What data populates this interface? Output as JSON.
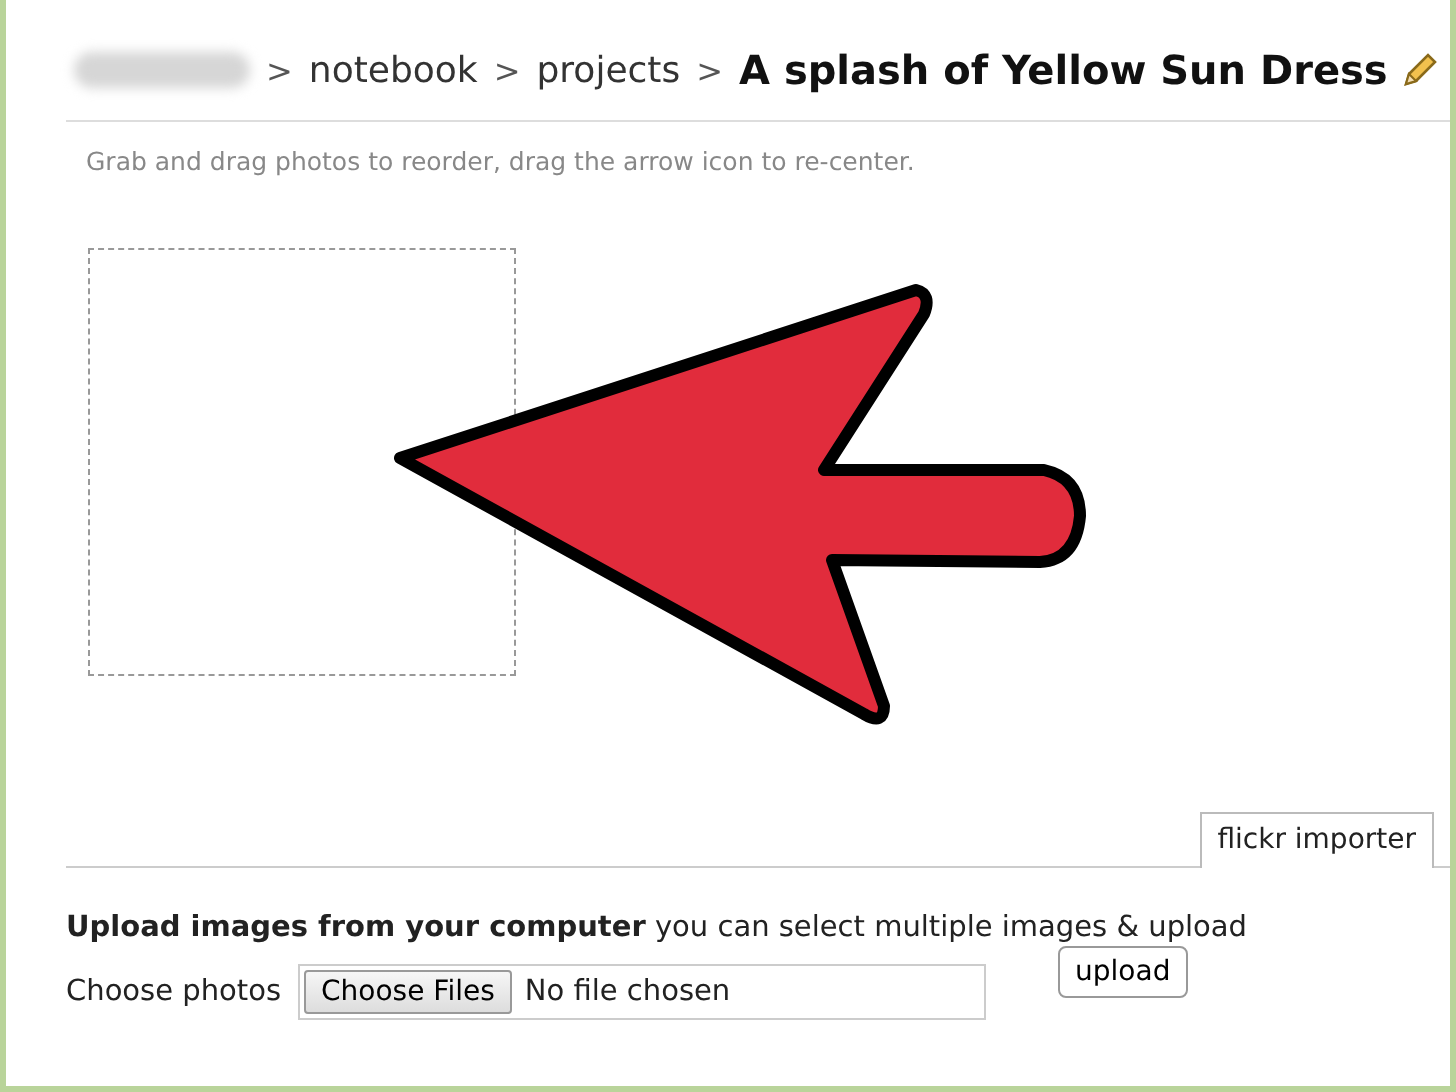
{
  "breadcrumb": {
    "items": [
      {
        "kind": "separator",
        "text": ">"
      },
      {
        "kind": "link",
        "text": "notebook"
      },
      {
        "kind": "separator",
        "text": ">"
      },
      {
        "kind": "link",
        "text": "projects"
      },
      {
        "kind": "separator",
        "text": ">"
      }
    ],
    "title": "A splash of Yellow Sun Dress"
  },
  "hint": "Grab and drag photos to reorder, drag the arrow icon to re-center.",
  "tabs": [
    {
      "label": "flickr importer",
      "selected": true
    }
  ],
  "upload": {
    "heading": "**Upload images from your computer** you can select multiple images & upload",
    "label": "Choose photos",
    "file_button": "Choose Files",
    "file_status": "No file chosen",
    "submit": "upload"
  }
}
